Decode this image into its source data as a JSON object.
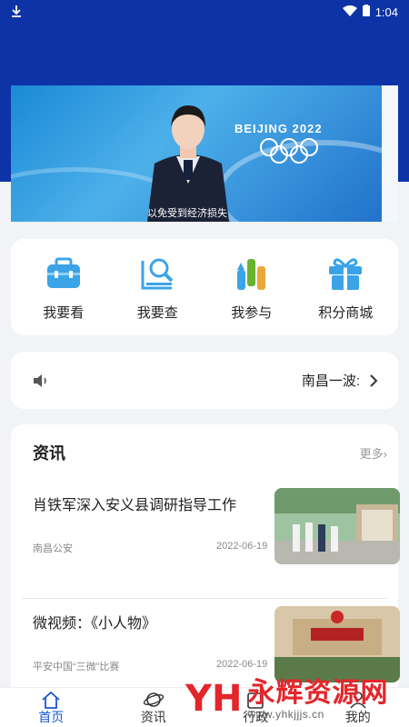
{
  "status_bar": {
    "time": "1:04",
    "download_icon": "download-icon",
    "wifi_icon": "wifi-icon",
    "battery_icon": "battery-icon"
  },
  "banner": {
    "logo_text": "BEIJING 2022",
    "caption": "以免受到经济损失"
  },
  "quick_links": [
    {
      "label": "我要看",
      "icon": "toolbox-icon"
    },
    {
      "label": "我要查",
      "icon": "search-document-icon"
    },
    {
      "label": "我参与",
      "icon": "raised-hands-icon"
    },
    {
      "label": "积分商城",
      "icon": "gift-icon"
    }
  ],
  "notice": {
    "icon": "speaker-icon",
    "text": "南昌一波:",
    "arrow_icon": "chevron-right-icon"
  },
  "news": {
    "title": "资讯",
    "more": "更多›",
    "items": [
      {
        "title": "肖铁军深入安义县调研指导工作",
        "source": "南昌公安",
        "date": "2022-06-19"
      },
      {
        "title": "微视频：《小人物》",
        "source": "平安中国“三微”比赛",
        "date": "2022-06-19"
      }
    ]
  },
  "tabbar": {
    "tabs": [
      {
        "label": "首页",
        "icon": "home-icon"
      },
      {
        "label": "资讯",
        "icon": "news-planet-icon"
      },
      {
        "label": "行政",
        "icon": "admin-icon"
      },
      {
        "label": "我的",
        "icon": "user-icon"
      }
    ]
  },
  "watermark": {
    "mark": "YH",
    "text": "永辉资源网",
    "url": "www.yhkjjjs.cn"
  },
  "colors": {
    "header": "#0e33a6",
    "accent": "#1a56d6",
    "icon_blue": "#3ba3e8",
    "icon_green": "#69b32f"
  }
}
